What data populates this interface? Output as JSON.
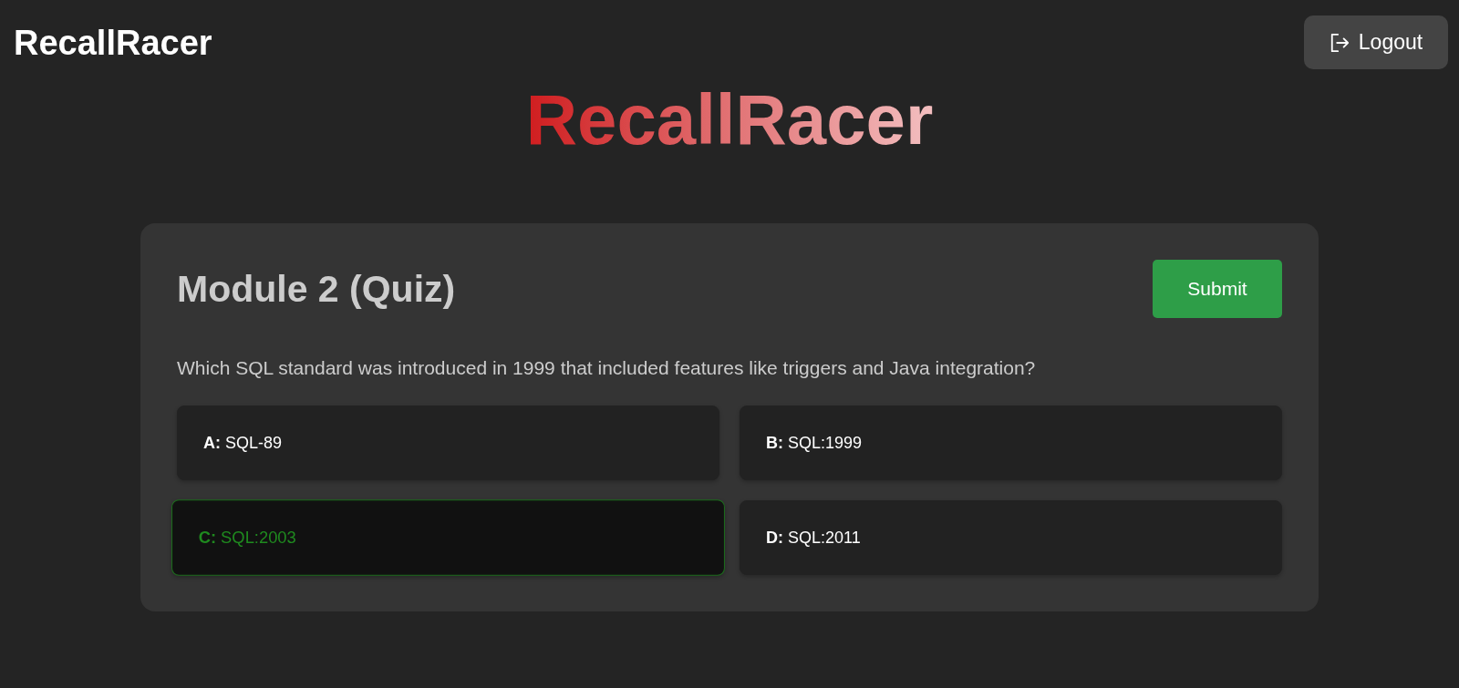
{
  "header": {
    "brand": "RecallRacer",
    "logout_button": {
      "label": "Logout"
    }
  },
  "hero_title": "RecallRacer",
  "quiz": {
    "title": "Module 2 (Quiz)",
    "submit_button": {
      "label": "Submit"
    },
    "question": "Which SQL standard was introduced in 1999 that included features like triggers and Java integration?",
    "options": [
      {
        "text": "**A:** SQL-89",
        "selected": false
      },
      {
        "text": "**B:** SQL:1999",
        "selected": false
      },
      {
        "text": "**C:** SQL:2003",
        "selected": true
      },
      {
        "text": "**D:** SQL:2011",
        "selected": false
      }
    ]
  }
}
